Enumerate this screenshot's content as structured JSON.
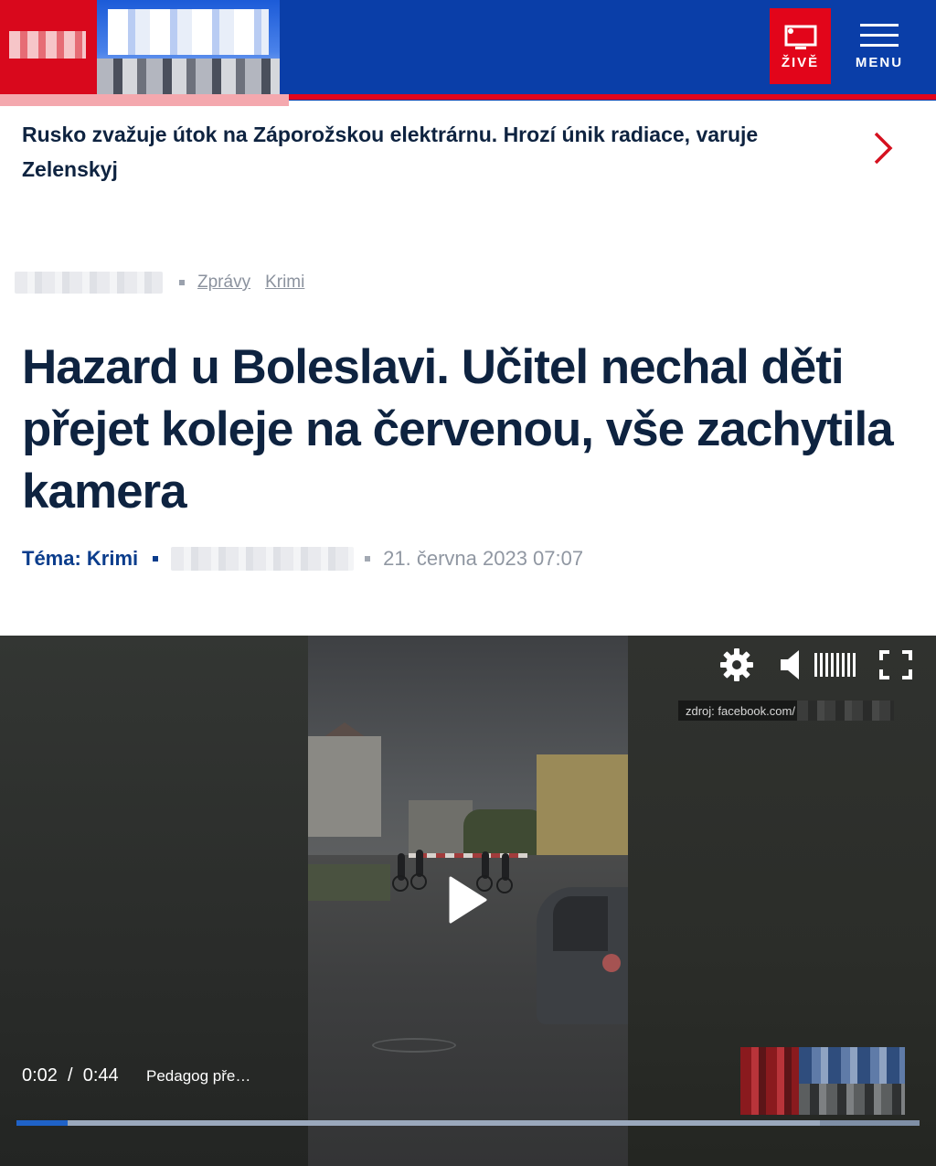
{
  "header": {
    "live_label": "ŽIVĚ",
    "menu_label": "MENU",
    "brand_colors": {
      "header_bg": "#0a3ea8",
      "accent_red": "#e2051a"
    }
  },
  "breaking": {
    "text": "Rusko zvažuje útok na Záporožskou elektrárnu. Hrozí únik radiace, varuje Zelenskyj"
  },
  "breadcrumb": {
    "items": [
      "Zprávy",
      "Krimi"
    ]
  },
  "article": {
    "title": "Hazard u Boleslavi. Učitel nechal děti přejet koleje na červenou, vše zachytila kamera",
    "topic": "Téma: Krimi",
    "date": "21. června 2023 07:07"
  },
  "video": {
    "time": "0:02  /  0:44",
    "title": "Pedagog pře…",
    "source_prefix": "zdroj: facebook.com/",
    "progress_played": 0.057,
    "progress_buffered": 0.89
  }
}
